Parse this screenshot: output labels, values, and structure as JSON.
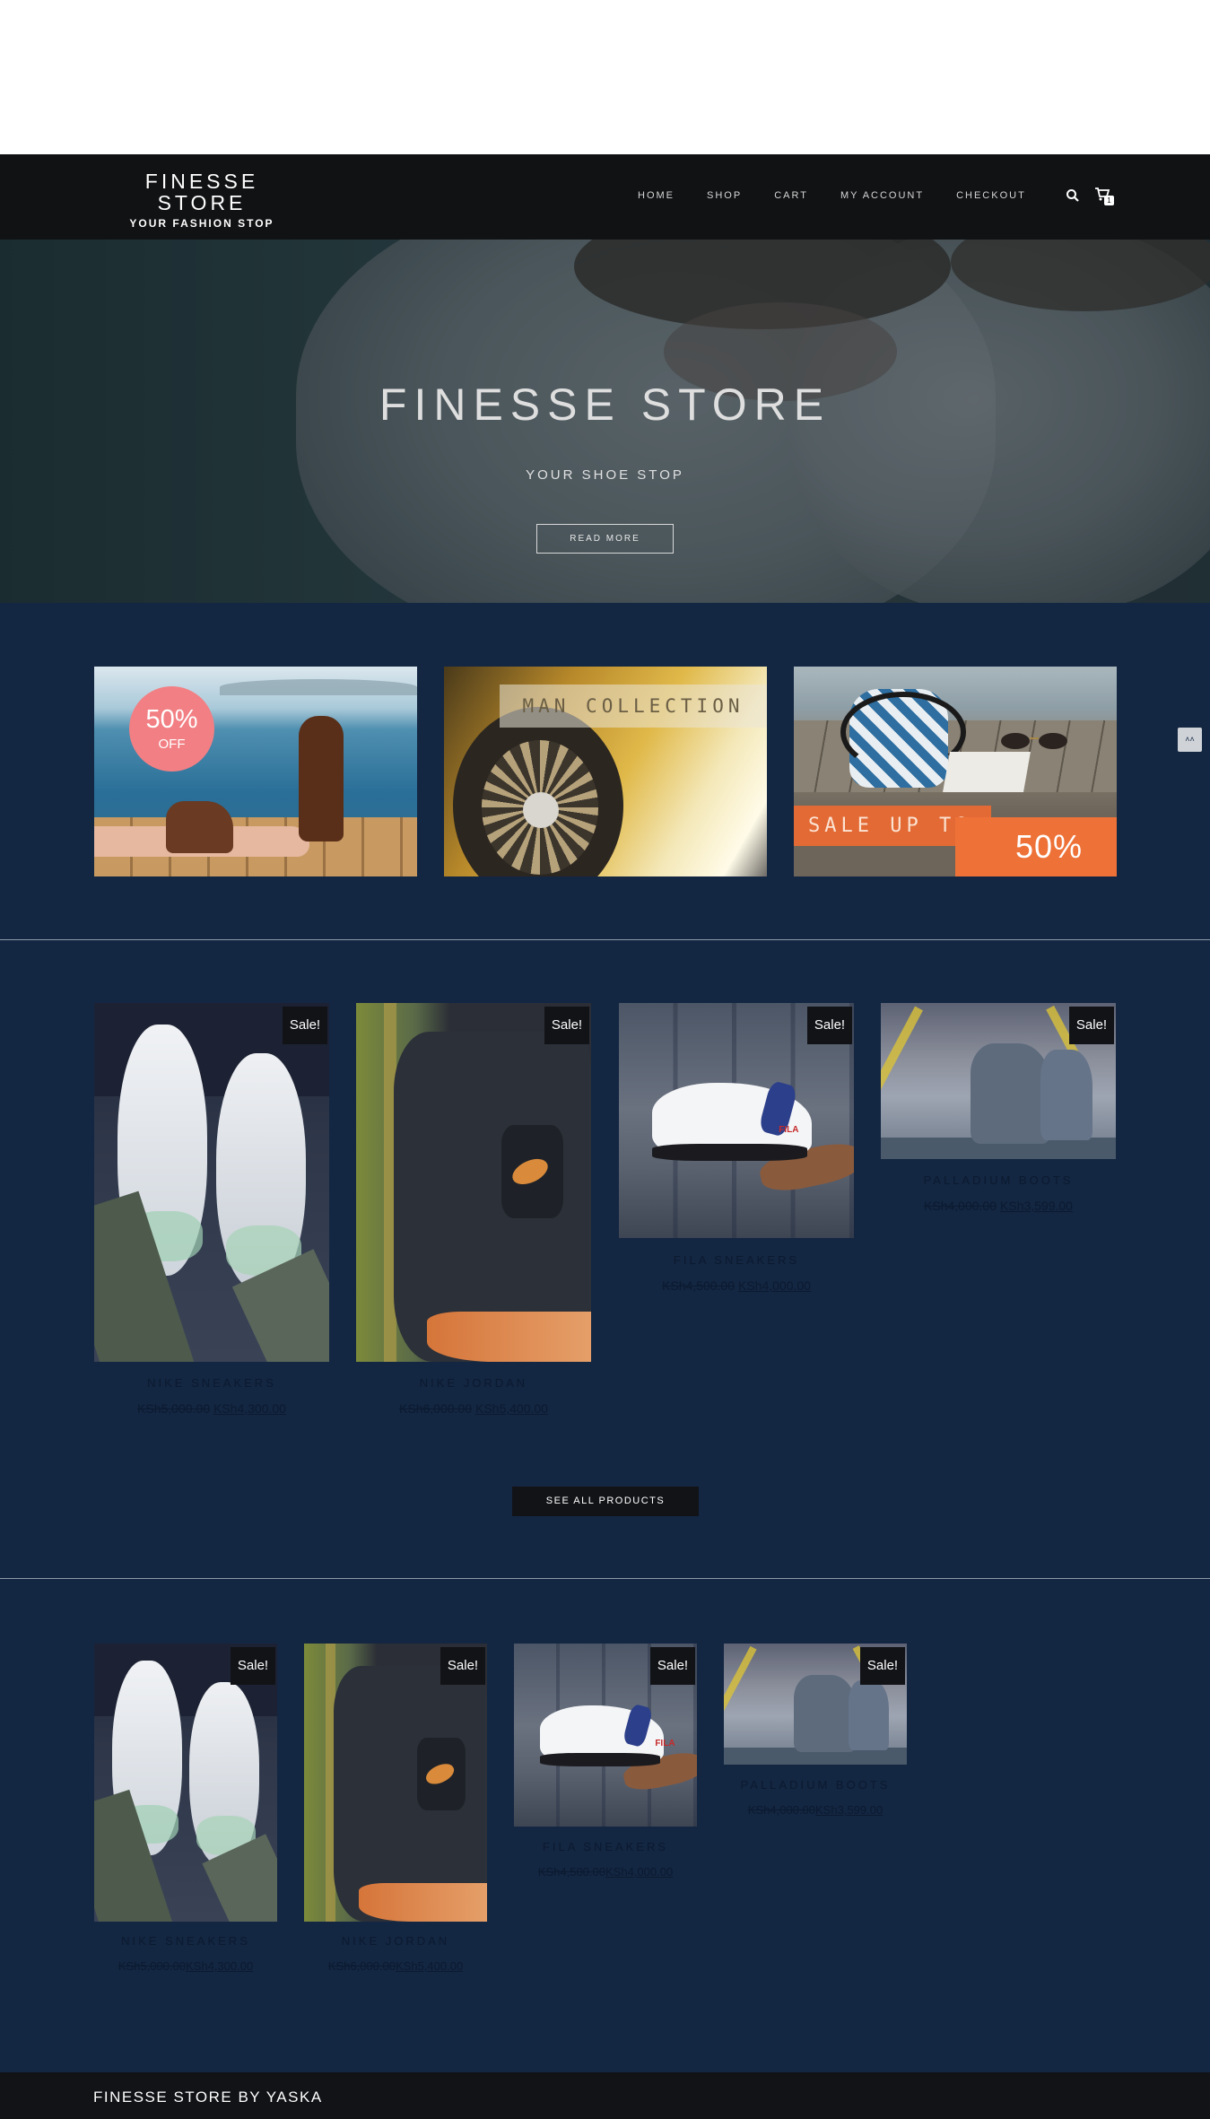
{
  "header": {
    "logo_title": "FINESSE STORE",
    "logo_tagline": "YOUR FASHION STOP",
    "nav": [
      "HOME",
      "SHOP",
      "CART",
      "MY ACCOUNT",
      "CHECKOUT"
    ],
    "cart_count": "1",
    "icons": [
      "search-icon",
      "cart-icon"
    ]
  },
  "hero": {
    "title": "FINESSE STORE",
    "subtitle": "YOUR SHOE STOP",
    "button": "READ MORE"
  },
  "promos": {
    "badge_pct": "50%",
    "badge_off": "OFF",
    "man_collection": "MAN COLLECTION",
    "sale_up_to": "SALE UP TO",
    "sale_pct": "50%"
  },
  "scroll_top_icon": "double-chevron-up-icon",
  "products": [
    {
      "name": "NIKE SNEAKERS",
      "old_price": "KSh5,000.00",
      "new_price": "KSh4,300.00",
      "sale": "Sale!"
    },
    {
      "name": "NIKE JORDAN",
      "old_price": "KSh6,000.00",
      "new_price": "KSh5,400.00",
      "sale": "Sale!"
    },
    {
      "name": "FILA SNEAKERS",
      "old_price": "KSh4,500.00",
      "new_price": "KSh4,000.00",
      "sale": "Sale!"
    },
    {
      "name": "PALLADIUM BOOTS",
      "old_price": "KSh4,000.00",
      "new_price": "KSh3,599.00",
      "sale": "Sale!"
    }
  ],
  "see_all": "SEE ALL PRODUCTS",
  "footer": "FINESSE STORE BY YASKA",
  "colors": {
    "navy": "#132642",
    "header": "#111214",
    "accent_orange": "#ee7238",
    "badge_pink": "#f27f83"
  }
}
